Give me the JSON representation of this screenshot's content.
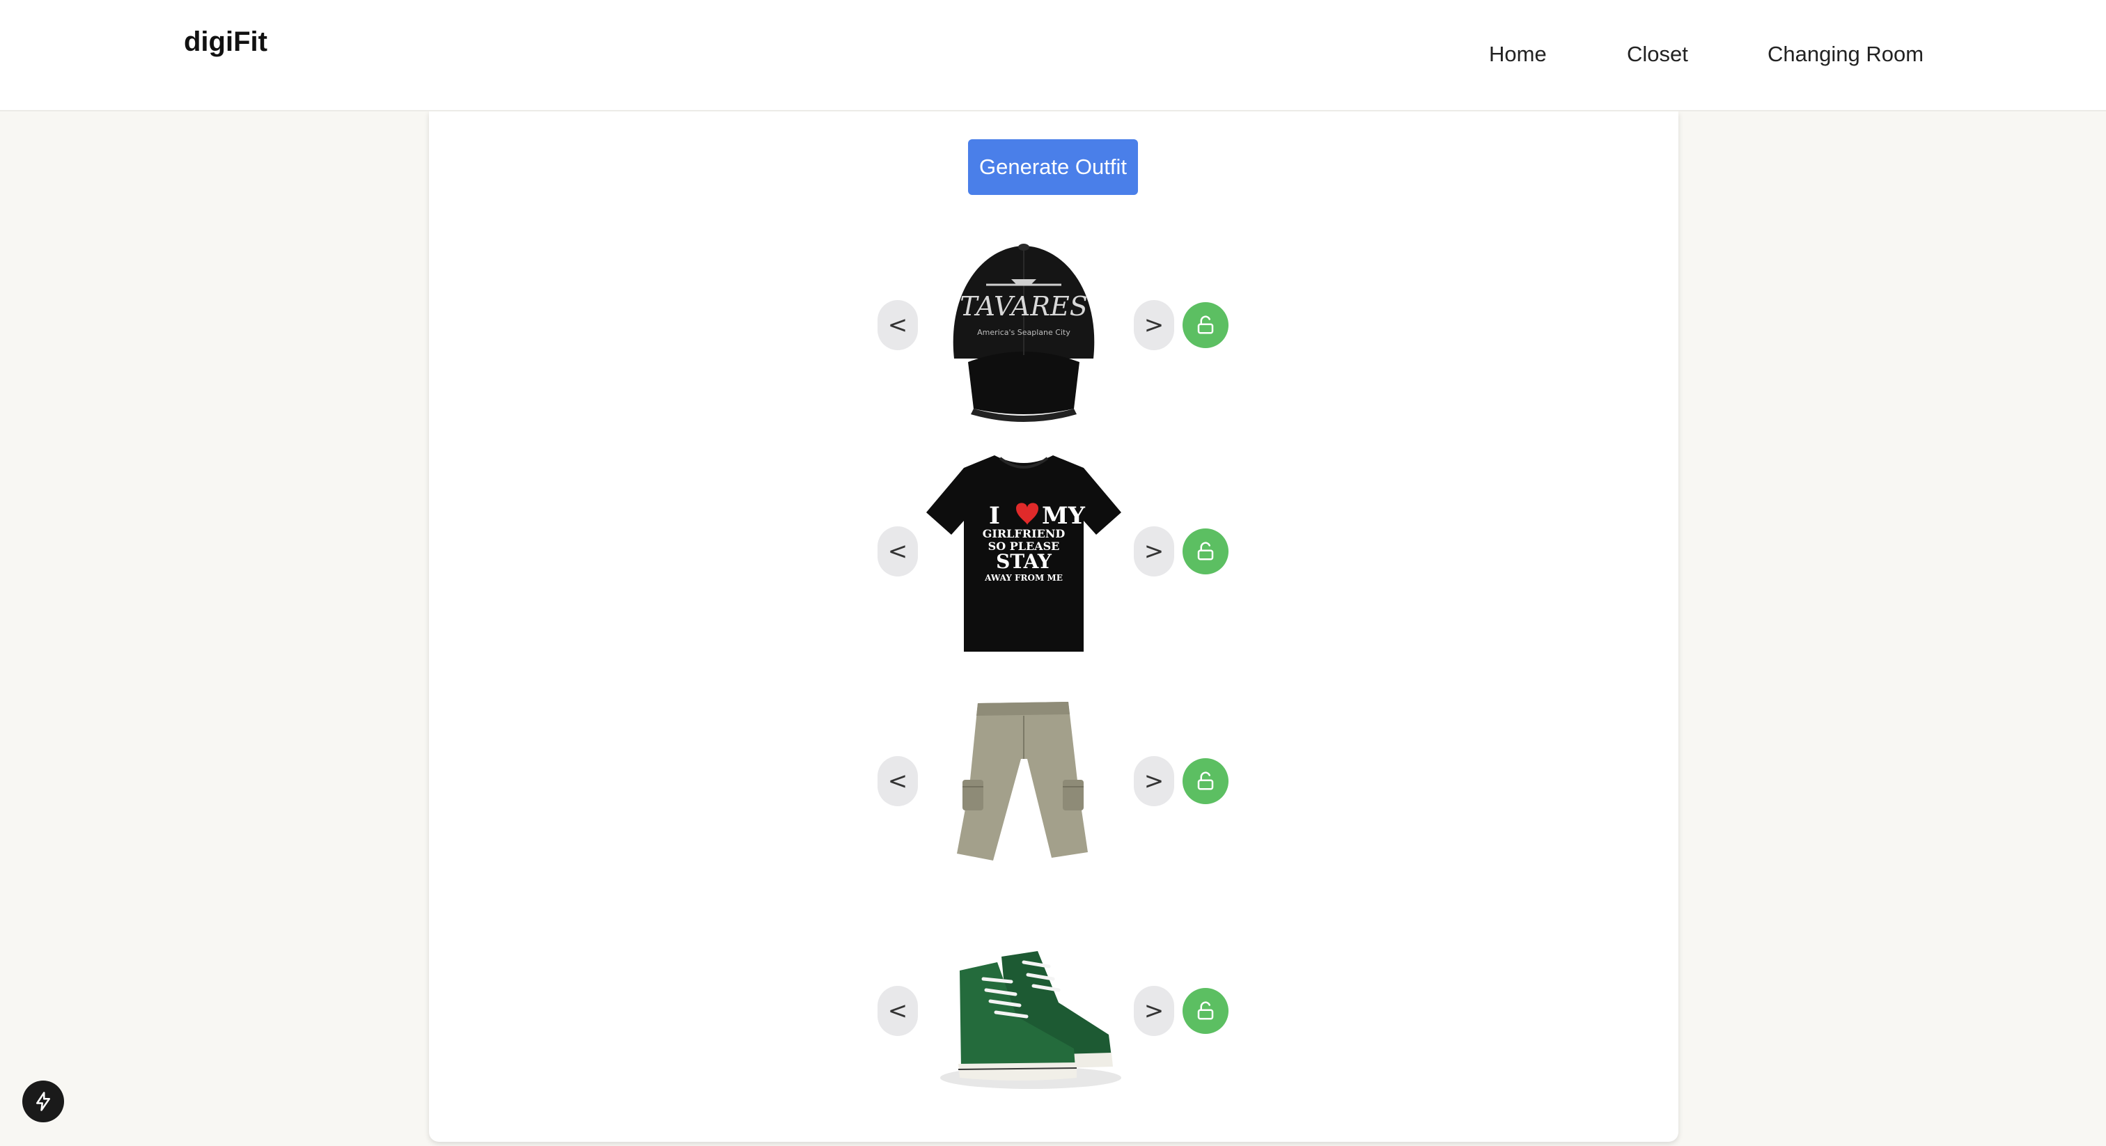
{
  "header": {
    "brand": "digiFit",
    "nav": [
      {
        "label": "Home"
      },
      {
        "label": "Closet"
      },
      {
        "label": "Changing Room"
      }
    ]
  },
  "main": {
    "generate_label": "Generate Outfit",
    "prev_label": "<",
    "next_label": ">",
    "items": [
      {
        "category": "hat",
        "print_main": "TAVARES",
        "print_sub": "America's Seaplane City",
        "locked": false
      },
      {
        "category": "shirt",
        "print_lines": [
          "I",
          "MY",
          "GIRLFRIEND",
          "SO PLEASE",
          "STAY",
          "AWAY FROM ME"
        ],
        "locked": false
      },
      {
        "category": "pants",
        "locked": false
      },
      {
        "category": "shoes",
        "locked": false
      }
    ]
  },
  "colors": {
    "accent": "#4a7fe9",
    "lock_green": "#5cbf62",
    "page_bg": "#f8f7f3"
  },
  "icons": {
    "lock": "unlock-icon",
    "fab": "lightning-icon"
  }
}
